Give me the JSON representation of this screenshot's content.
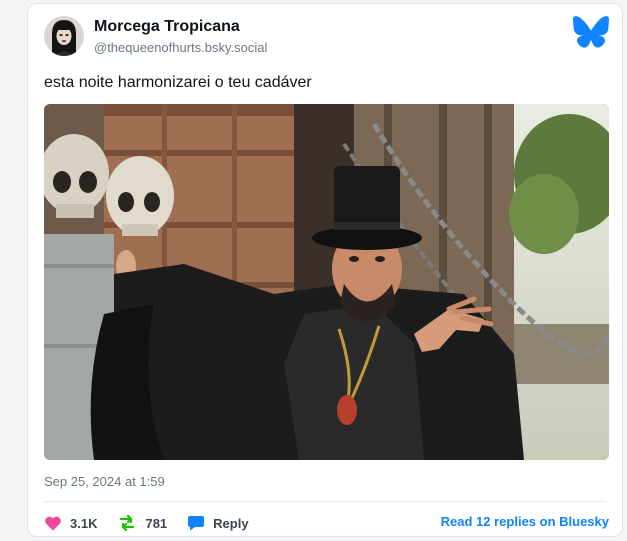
{
  "author": {
    "name": "Morcega Tropicana",
    "handle": "@thequeenofhurts.bsky.social",
    "avatar_icon": "avatar-portrait-icon"
  },
  "post": {
    "text": "esta noite harmonizarei o teu cadáver",
    "image_icon": "photo-man-in-top-hat-and-cape-beside-skulls",
    "timestamp": "Sep 25, 2024 at 1:59"
  },
  "stats": {
    "likes": "3.1K",
    "reposts": "781",
    "reply_label": "Reply"
  },
  "read_replies_label": "Read 12 replies on Bluesky",
  "colors": {
    "brand": "#1083fe",
    "like": "#ec4899",
    "repost": "#20bc07",
    "reply": "#1083fe",
    "text": "#0f1419",
    "muted": "#6b7683"
  }
}
